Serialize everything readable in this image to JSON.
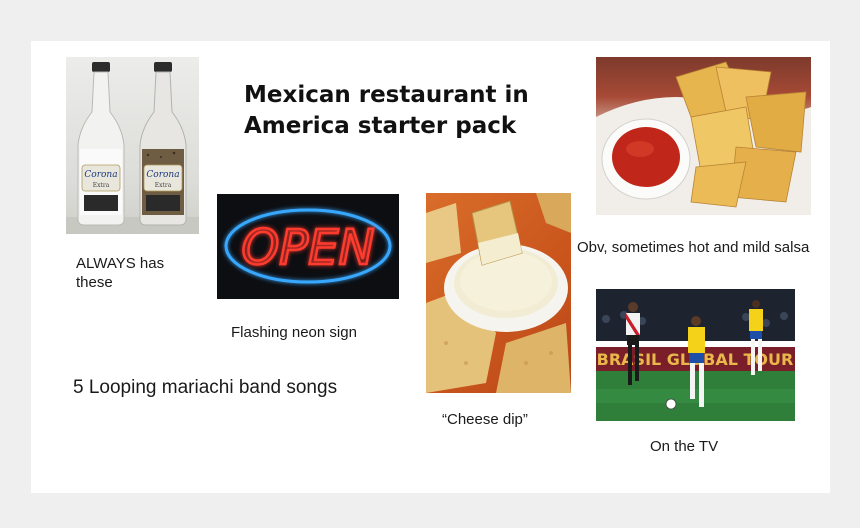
{
  "title": "Mexican restaurant in America starter pack",
  "captions": {
    "bottles": "ALWAYS has these",
    "neon": "Flashing neon sign",
    "mariachi": "5 Looping mariachi band songs",
    "dip": "“Cheese dip”",
    "salsa": "Obv, sometimes hot and mild salsa",
    "tv": "On the TV"
  },
  "image_text": {
    "bottle_brand": "Corona",
    "bottle_sub": "Extra",
    "neon_word": "OPEN",
    "banner": "BRASIL GLOBAL TOUR"
  },
  "colors": {
    "neon_red": "#ff3b2f",
    "neon_blue": "#39a8ff",
    "salsa": "#c0271a",
    "pitch": "#2f7f3a",
    "brazil_yellow": "#f4d21a",
    "peru_red": "#c81e2a"
  }
}
